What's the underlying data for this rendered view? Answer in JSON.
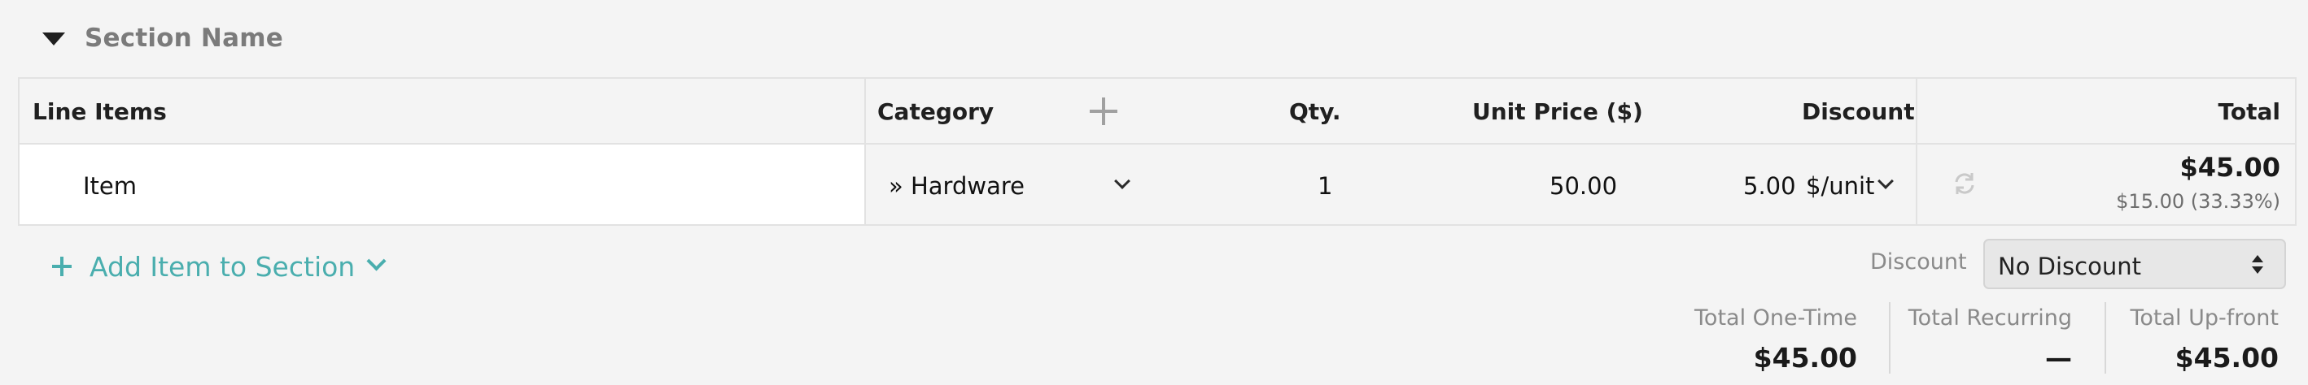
{
  "section": {
    "name": "Section Name"
  },
  "table": {
    "headers": {
      "line_items": "Line Items",
      "category": "Category",
      "qty": "Qty.",
      "unit_price": "Unit Price ($)",
      "discount": "Discount",
      "total": "Total"
    },
    "row": {
      "item": "Item",
      "category": "» Hardware",
      "qty": "1",
      "unit_price": "50.00",
      "discount_value": "5.00",
      "discount_unit": "$/unit",
      "total": "$45.00",
      "total_sub": "$15.00 (33.33%)"
    }
  },
  "add_item": {
    "label": "Add Item to Section"
  },
  "discount": {
    "label": "Discount",
    "selected": "No Discount"
  },
  "totals": {
    "one_time": {
      "label": "Total One-Time",
      "value": "$45.00"
    },
    "recurring": {
      "label": "Total Recurring",
      "value": "—"
    },
    "upfront": {
      "label": "Total Up-front",
      "value": "$45.00"
    }
  },
  "colors": {
    "accent": "#4aaeae",
    "muted": "#8a8a8a",
    "border": "#e2e2e2"
  },
  "icons": [
    "caret-down-icon",
    "plus-icon",
    "chevron-down-icon",
    "refresh-icon",
    "select-updown-icon"
  ]
}
